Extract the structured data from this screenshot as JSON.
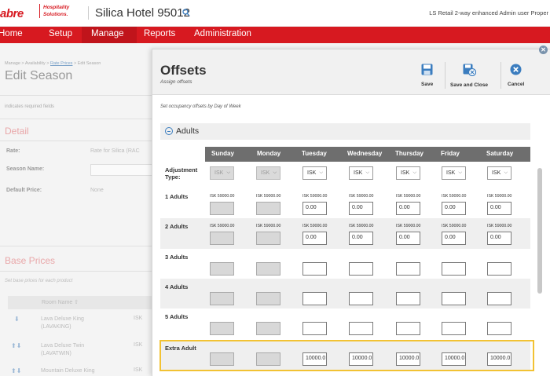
{
  "header": {
    "logo": "abre",
    "logo_sub_line1": "Hospitality",
    "logo_sub_line2": "Solutions.",
    "hotel_name": "Silica Hotel 95012",
    "user_info": "LS Retail 2-way enhanced Admin user Proper"
  },
  "nav": {
    "items": [
      "Home",
      "Setup",
      "Manage",
      "Reports",
      "Administration"
    ],
    "active": "Manage"
  },
  "background_page": {
    "breadcrumb_prefix": "Manage > Availability > ",
    "breadcrumb_link": "Rate Prices",
    "breadcrumb_suffix": " > Edit Season",
    "title": "Edit Season",
    "required_note": "indicates required fields",
    "detail_section": "Detail",
    "rate_label": "Rate:",
    "rate_value": "Rate for Silica (RAC",
    "season_name_label": "Season Name:",
    "default_price_label": "Default Price:",
    "default_price_value": "None",
    "base_prices_section": "Base Prices",
    "base_prices_hint": "Set base prices for each product",
    "room_name_header": "Room Name ⇧",
    "rooms": [
      {
        "name": "Lava Deluxe King",
        "code": "(LAVAKING)",
        "isk": "ISK"
      },
      {
        "name": "Lava Deluxe Twin",
        "code": "(LAVATWIN)",
        "isk": "ISK"
      },
      {
        "name": "Mountain Deluxe King",
        "code": "",
        "isk": "ISK"
      }
    ]
  },
  "modal": {
    "title": "Offsets",
    "subtitle": "Assign offsets",
    "buttons": {
      "save": "Save",
      "save_close": "Save and Close",
      "cancel": "Cancel"
    },
    "hint": "Set occupancy offsets by Day of Week",
    "group_label": "Adults",
    "days": [
      "Sunday",
      "Monday",
      "Tuesday",
      "Wednesday",
      "Thursday",
      "Friday",
      "Saturday"
    ],
    "adjustment_type_label": "Adjustment Type:",
    "adjustment_value": "ISK",
    "rows": [
      {
        "label": "1 Adults",
        "price": "ISK 59000.00",
        "has_price": true,
        "value": "0.00"
      },
      {
        "label": "2 Adults",
        "price": "ISK 59000.00",
        "has_price": true,
        "value": "0.00"
      },
      {
        "label": "3 Adults",
        "price": "",
        "has_price": false,
        "value": ""
      },
      {
        "label": "4 Adults",
        "price": "",
        "has_price": false,
        "value": ""
      },
      {
        "label": "5 Adults",
        "price": "",
        "has_price": false,
        "value": ""
      },
      {
        "label": "Extra Adult",
        "price": "",
        "has_price": false,
        "value": "10000.0"
      }
    ]
  },
  "colors": {
    "brand_red": "#d71920",
    "grid_header": "#6e6e6e",
    "highlight": "#f2c233",
    "cancel_icon": "#3b7dbf"
  }
}
